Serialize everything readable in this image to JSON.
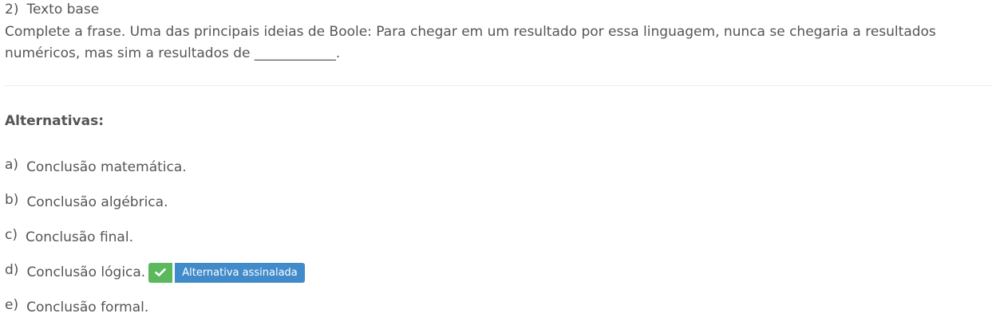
{
  "question": {
    "number": "2)",
    "header": "Texto base",
    "statement": "Complete a frase. Uma das principais ideias de Boole: Para chegar em um resultado por essa linguagem, nunca se chegaria a resultados numéricos, mas sim a resultados de ____________."
  },
  "alternatives": {
    "title": "Alternativas:",
    "items": [
      {
        "letter": "a)",
        "text": "Conclusão matemática."
      },
      {
        "letter": "b)",
        "text": "Conclusão algébrica."
      },
      {
        "letter": "c)",
        "text": "Conclusão final."
      },
      {
        "letter": "d)",
        "text": "Conclusão lógica.",
        "selected_label": "Alternativa assinalada"
      },
      {
        "letter": "e)",
        "text": "Conclusão formal."
      }
    ]
  },
  "icons": {
    "selected": "check-icon"
  },
  "colors": {
    "text": "#555555",
    "check_badge": "#5cb85c",
    "label_badge": "#428bca",
    "divider": "#eeeeee"
  }
}
